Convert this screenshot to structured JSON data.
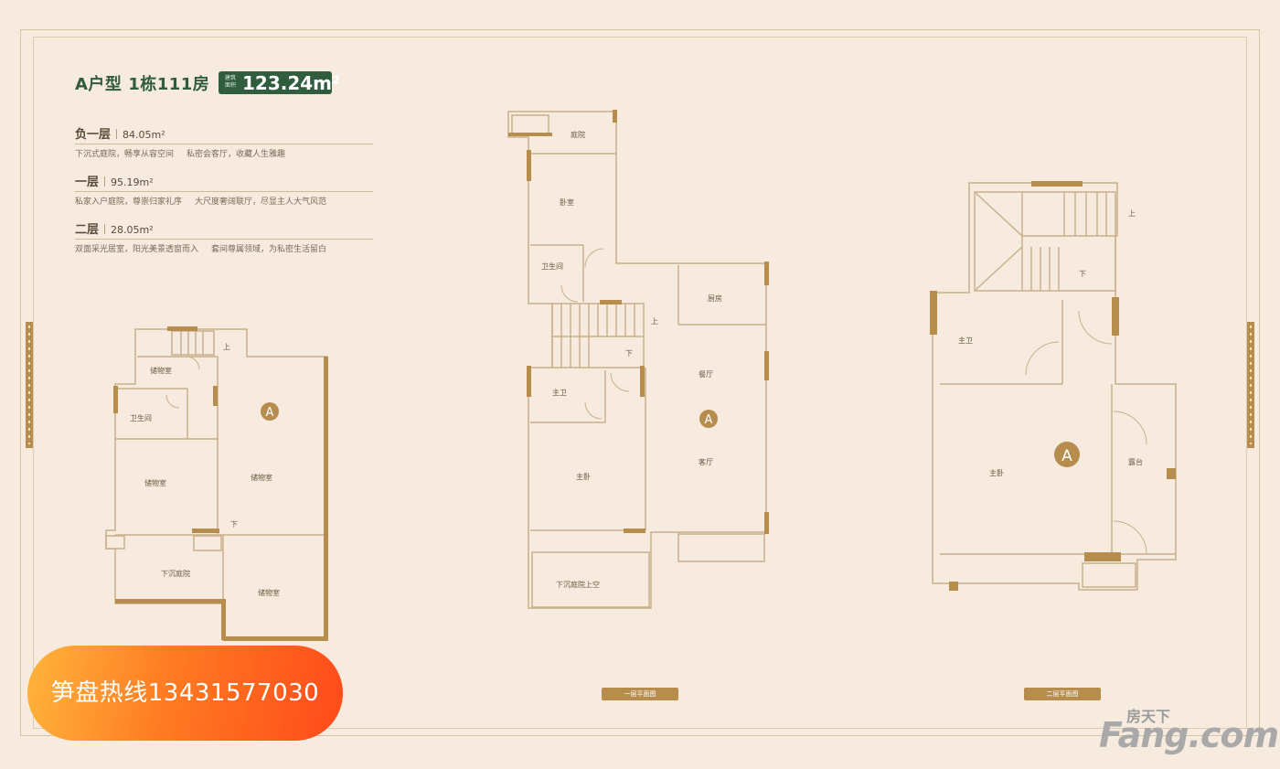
{
  "header": {
    "title": "A户型  1栋111房",
    "area_label": "建筑面积",
    "area_value": "123.24m²"
  },
  "floors": [
    {
      "name": "负一层",
      "area": "84.05m²",
      "desc": [
        "下沉式庭院，畅享从容空间",
        "私密会客厅，收藏人生雅趣"
      ]
    },
    {
      "name": "一层",
      "area": "95.19m²",
      "desc": [
        "私家入户庭院，尊崇归家礼序",
        "大尺度奢阔联厅，尽显主人大气风范"
      ]
    },
    {
      "name": "二层",
      "area": "28.05m²",
      "desc": [
        "双面采光居室，阳光美景透窗而入",
        "套间尊属领域，为私密生活留白"
      ]
    }
  ],
  "plans": {
    "basement": {
      "rooms": [
        "储物室",
        "卫生间",
        "储物室",
        "储物室",
        "下沉庭院",
        "储物室"
      ],
      "stairs": "上",
      "stairs_down": "下",
      "unit_marker": "A"
    },
    "first": {
      "rooms": [
        "庭院",
        "卧室",
        "卫生间",
        "厨房",
        "餐厅",
        "主卫",
        "主卧",
        "客厅",
        "下沉庭院上空"
      ],
      "stairs_up": "上",
      "stairs_down": "下",
      "unit_marker": "A",
      "label": "一层平面图"
    },
    "second": {
      "rooms": [
        "主卫",
        "主卧",
        "露台"
      ],
      "stairs_up": "上",
      "stairs_down": "下",
      "unit_marker": "A",
      "label": "二层平面图"
    }
  },
  "hotline": "笋盘热线13431577030",
  "watermark": {
    "top": "房天下",
    "main": "Fang.com"
  },
  "colors": {
    "background": "#f6ebde",
    "brand_green": "#2f5d3d",
    "wall_gold": "#b78d4e",
    "hotline_orange": "#ff6a20"
  }
}
